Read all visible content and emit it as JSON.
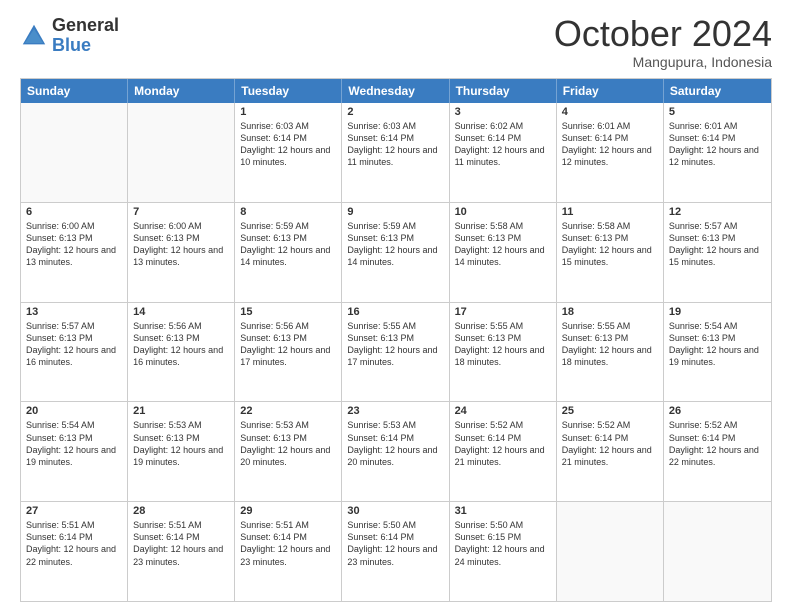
{
  "logo": {
    "general": "General",
    "blue": "Blue"
  },
  "title": "October 2024",
  "location": "Mangupura, Indonesia",
  "days": [
    "Sunday",
    "Monday",
    "Tuesday",
    "Wednesday",
    "Thursday",
    "Friday",
    "Saturday"
  ],
  "weeks": [
    [
      {
        "day": "",
        "info": ""
      },
      {
        "day": "",
        "info": ""
      },
      {
        "day": "1",
        "info": "Sunrise: 6:03 AM\nSunset: 6:14 PM\nDaylight: 12 hours and 10 minutes."
      },
      {
        "day": "2",
        "info": "Sunrise: 6:03 AM\nSunset: 6:14 PM\nDaylight: 12 hours and 11 minutes."
      },
      {
        "day": "3",
        "info": "Sunrise: 6:02 AM\nSunset: 6:14 PM\nDaylight: 12 hours and 11 minutes."
      },
      {
        "day": "4",
        "info": "Sunrise: 6:01 AM\nSunset: 6:14 PM\nDaylight: 12 hours and 12 minutes."
      },
      {
        "day": "5",
        "info": "Sunrise: 6:01 AM\nSunset: 6:14 PM\nDaylight: 12 hours and 12 minutes."
      }
    ],
    [
      {
        "day": "6",
        "info": "Sunrise: 6:00 AM\nSunset: 6:13 PM\nDaylight: 12 hours and 13 minutes."
      },
      {
        "day": "7",
        "info": "Sunrise: 6:00 AM\nSunset: 6:13 PM\nDaylight: 12 hours and 13 minutes."
      },
      {
        "day": "8",
        "info": "Sunrise: 5:59 AM\nSunset: 6:13 PM\nDaylight: 12 hours and 14 minutes."
      },
      {
        "day": "9",
        "info": "Sunrise: 5:59 AM\nSunset: 6:13 PM\nDaylight: 12 hours and 14 minutes."
      },
      {
        "day": "10",
        "info": "Sunrise: 5:58 AM\nSunset: 6:13 PM\nDaylight: 12 hours and 14 minutes."
      },
      {
        "day": "11",
        "info": "Sunrise: 5:58 AM\nSunset: 6:13 PM\nDaylight: 12 hours and 15 minutes."
      },
      {
        "day": "12",
        "info": "Sunrise: 5:57 AM\nSunset: 6:13 PM\nDaylight: 12 hours and 15 minutes."
      }
    ],
    [
      {
        "day": "13",
        "info": "Sunrise: 5:57 AM\nSunset: 6:13 PM\nDaylight: 12 hours and 16 minutes."
      },
      {
        "day": "14",
        "info": "Sunrise: 5:56 AM\nSunset: 6:13 PM\nDaylight: 12 hours and 16 minutes."
      },
      {
        "day": "15",
        "info": "Sunrise: 5:56 AM\nSunset: 6:13 PM\nDaylight: 12 hours and 17 minutes."
      },
      {
        "day": "16",
        "info": "Sunrise: 5:55 AM\nSunset: 6:13 PM\nDaylight: 12 hours and 17 minutes."
      },
      {
        "day": "17",
        "info": "Sunrise: 5:55 AM\nSunset: 6:13 PM\nDaylight: 12 hours and 18 minutes."
      },
      {
        "day": "18",
        "info": "Sunrise: 5:55 AM\nSunset: 6:13 PM\nDaylight: 12 hours and 18 minutes."
      },
      {
        "day": "19",
        "info": "Sunrise: 5:54 AM\nSunset: 6:13 PM\nDaylight: 12 hours and 19 minutes."
      }
    ],
    [
      {
        "day": "20",
        "info": "Sunrise: 5:54 AM\nSunset: 6:13 PM\nDaylight: 12 hours and 19 minutes."
      },
      {
        "day": "21",
        "info": "Sunrise: 5:53 AM\nSunset: 6:13 PM\nDaylight: 12 hours and 19 minutes."
      },
      {
        "day": "22",
        "info": "Sunrise: 5:53 AM\nSunset: 6:13 PM\nDaylight: 12 hours and 20 minutes."
      },
      {
        "day": "23",
        "info": "Sunrise: 5:53 AM\nSunset: 6:14 PM\nDaylight: 12 hours and 20 minutes."
      },
      {
        "day": "24",
        "info": "Sunrise: 5:52 AM\nSunset: 6:14 PM\nDaylight: 12 hours and 21 minutes."
      },
      {
        "day": "25",
        "info": "Sunrise: 5:52 AM\nSunset: 6:14 PM\nDaylight: 12 hours and 21 minutes."
      },
      {
        "day": "26",
        "info": "Sunrise: 5:52 AM\nSunset: 6:14 PM\nDaylight: 12 hours and 22 minutes."
      }
    ],
    [
      {
        "day": "27",
        "info": "Sunrise: 5:51 AM\nSunset: 6:14 PM\nDaylight: 12 hours and 22 minutes."
      },
      {
        "day": "28",
        "info": "Sunrise: 5:51 AM\nSunset: 6:14 PM\nDaylight: 12 hours and 23 minutes."
      },
      {
        "day": "29",
        "info": "Sunrise: 5:51 AM\nSunset: 6:14 PM\nDaylight: 12 hours and 23 minutes."
      },
      {
        "day": "30",
        "info": "Sunrise: 5:50 AM\nSunset: 6:14 PM\nDaylight: 12 hours and 23 minutes."
      },
      {
        "day": "31",
        "info": "Sunrise: 5:50 AM\nSunset: 6:15 PM\nDaylight: 12 hours and 24 minutes."
      },
      {
        "day": "",
        "info": ""
      },
      {
        "day": "",
        "info": ""
      }
    ]
  ]
}
